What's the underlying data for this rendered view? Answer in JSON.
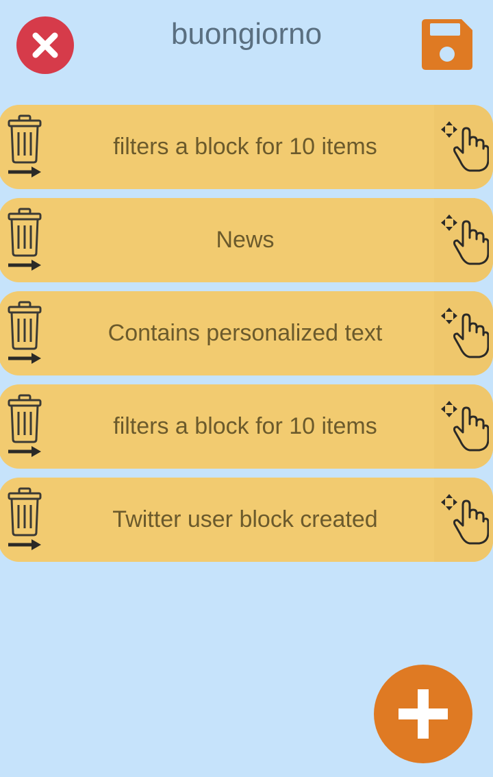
{
  "header": {
    "title": "buongiorno",
    "close_icon": "close-icon",
    "save_icon": "floppy-disk-icon"
  },
  "colors": {
    "background": "#c6e3fb",
    "item": "#f2cb70",
    "close": "#d63b4a",
    "accent": "#df7a23",
    "title": "#5a6f80",
    "item_text": "#6b5a2c"
  },
  "items": [
    {
      "label": "filters a block for 10 items"
    },
    {
      "label": "News"
    },
    {
      "label": "Contains personalized text"
    },
    {
      "label": "filters a block for 10 items"
    },
    {
      "label": "Twitter user block created"
    }
  ],
  "icons": {
    "delete": "trash-icon",
    "drag": "drag-hand-icon",
    "add": "plus-icon"
  }
}
